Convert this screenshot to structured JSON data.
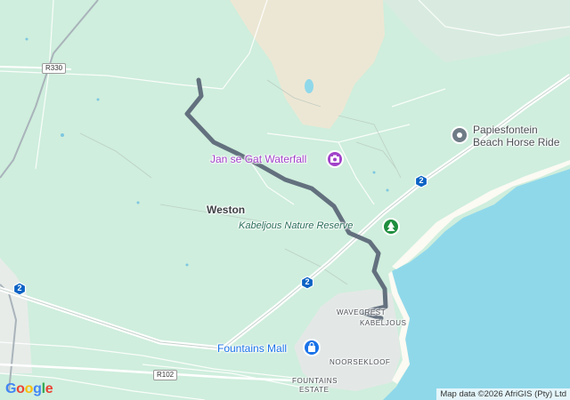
{
  "map": {
    "places": {
      "weston": "Weston",
      "wavecrest": "WAVECREST",
      "kabeljous": "KABELJOUS",
      "noorsekloof": "NOORSEKLOOF",
      "fountains_estate_line1": "FOUNTAINS",
      "fountains_estate_line2": "ESTATE"
    },
    "pois": {
      "waterfall": "Jan se Gat Waterfall",
      "nature_reserve": "Kabeljous Nature Reserve",
      "mall": "Fountains Mall",
      "beach_ride_line1": "Papiesfontein",
      "beach_ride_line2": "Beach Horse Ride"
    },
    "roads": {
      "r330": "R330",
      "r102": "R102",
      "n2_a": "2",
      "n2_b": "2",
      "n2_c": "2"
    },
    "attribution": "Map data ©2026 AfriGIS (Pty) Ltd",
    "logo": "Google",
    "colors": {
      "land": "#cfeedd",
      "sea": "#8fd8ea",
      "sand": "#ece7d4",
      "route": "#63707e",
      "highway": "#ffffff",
      "poi_purple": "#a142c9",
      "poi_blue": "#1a73e8",
      "poi_green": "#1e8e3e",
      "poi_grey": "#6f7b86",
      "hex_shield": "#0b63c5"
    }
  }
}
